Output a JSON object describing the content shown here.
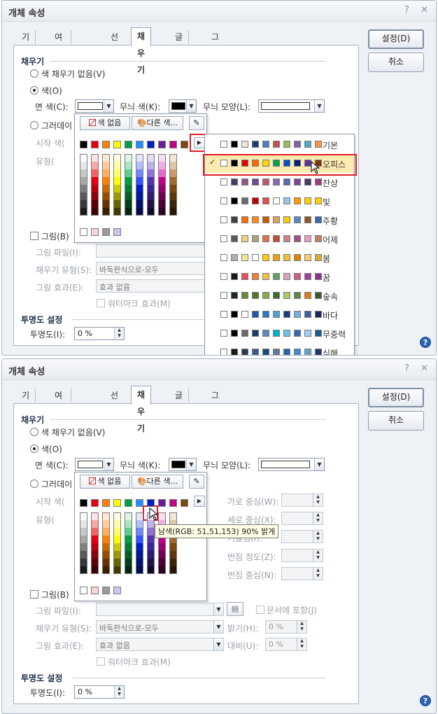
{
  "window": {
    "title": "개체 속성",
    "help_glyph": "?",
    "close_glyph": "✕"
  },
  "tabs": [
    "기본",
    "여백/캡션",
    "선",
    "채우기",
    "글상자",
    "그림자"
  ],
  "active_tab": "채우기",
  "buttons": {
    "ok": "설정(D)",
    "cancel": "취소"
  },
  "fill": {
    "section": "채우기",
    "no_fill": "색 채우기 없음(V)",
    "color": "색(O)",
    "face_color": "면 색(C):",
    "pattern_color": "무늬 색(K):",
    "pattern_shape": "무늬 모양(L):",
    "gradient": "그러데이션(G)",
    "gradient_short": "그러데이",
    "start_color": "시작 색(G)",
    "start_color_short": "시작 색(",
    "type_label": "유형(T):",
    "type_short": "유형(",
    "h_center": "가로 중심(W):",
    "v_center": "세로 중심(X):",
    "tilt": "기울임(I):",
    "spread": "번짐 정도(Z):",
    "spread_center": "번짐 중심(N):",
    "picture": "그림(B)",
    "picture_file": "그림 파일(I):",
    "fill_type": "채우기 유형(S):",
    "fill_type_value": "바둑판식으로-모두",
    "picture_effect": "그림 효과(E):",
    "picture_effect_value": "효과 없음",
    "watermark": "워터마크 효과(M)",
    "include_doc": "문서에 포함(J)",
    "brightness": "밝기(H):",
    "brightness_value": "0 %",
    "contrast": "대비(U):",
    "contrast_value": "0 %"
  },
  "transparency": {
    "section": "투명도 설정",
    "label": "투명도(I):",
    "value": "0 %"
  },
  "palette": {
    "no_color": "색 없음",
    "other_colors": "다른 색..."
  },
  "themes": [
    "기본",
    "오피스",
    "잔상",
    "빛",
    "주황",
    "어제",
    "봄",
    "꿈",
    "숲속",
    "바다",
    "무중력",
    "심해"
  ],
  "selected_theme": "오피스",
  "tooltip": "남색(RGB: 51,51,153) 90% 밝게",
  "colors": {
    "accent_red": "#e31b23",
    "tab_border": "#9aa7b6",
    "help_blue": "#2b62b5"
  }
}
